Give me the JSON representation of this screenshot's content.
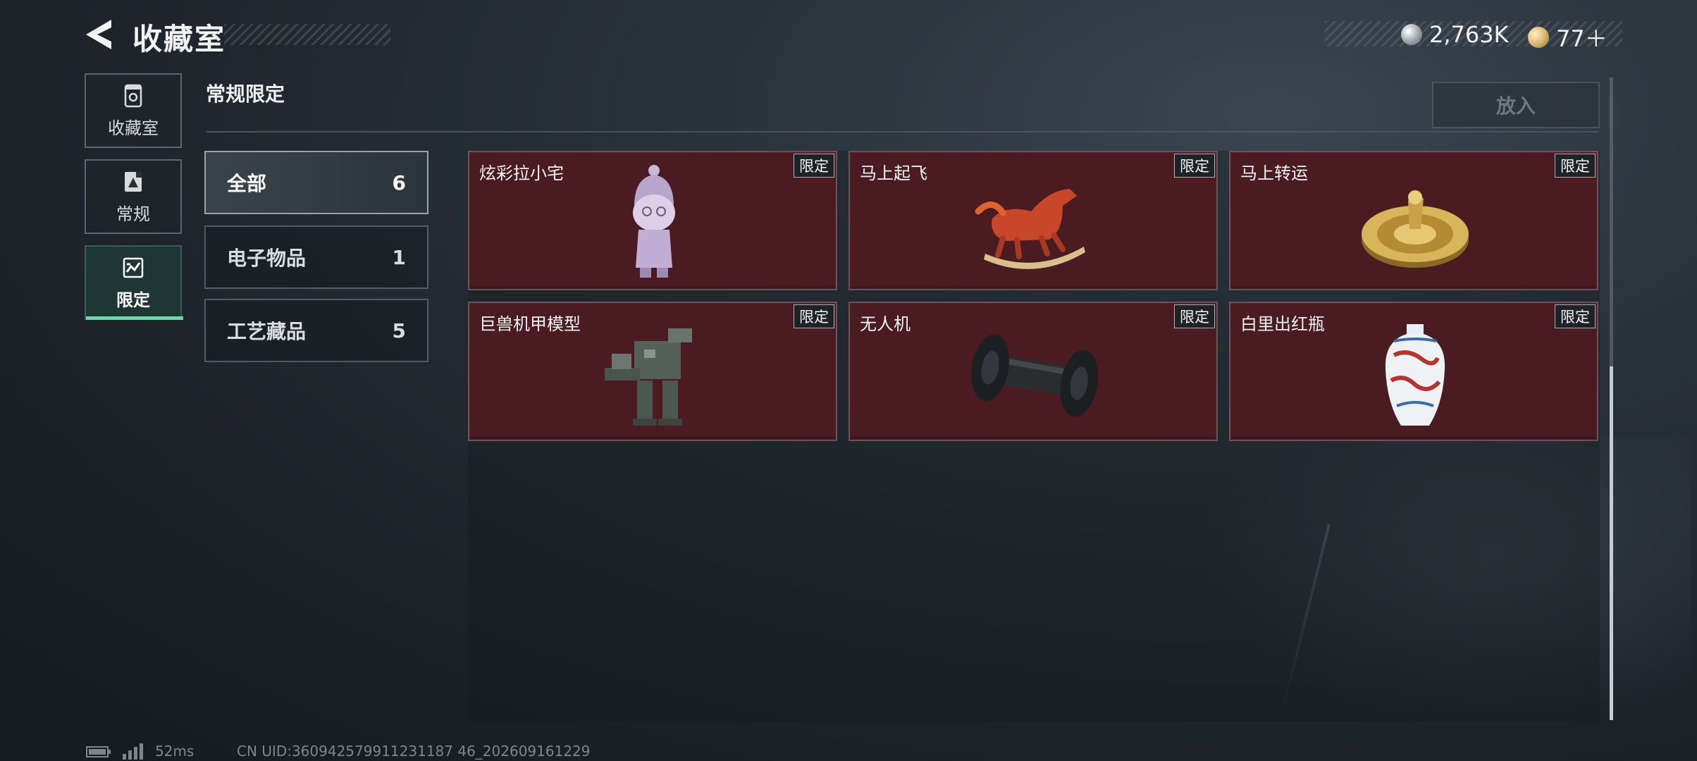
{
  "header": {
    "title": "收藏室",
    "currencies": [
      {
        "icon": "silver-coin-icon",
        "value": "2,763K"
      },
      {
        "icon": "gold-coin-icon",
        "value": "77＋"
      }
    ]
  },
  "nav": {
    "items": [
      {
        "label": "收藏室",
        "icon": "collection-box-icon",
        "active": false
      },
      {
        "label": "常规",
        "icon": "standard-icon",
        "active": false
      },
      {
        "label": "限定",
        "icon": "limited-icon",
        "active": true
      }
    ]
  },
  "section": {
    "title": "常规限定",
    "put_in_label": "放入"
  },
  "filters": [
    {
      "label": "全部",
      "count": "6",
      "active": true
    },
    {
      "label": "电子物品",
      "count": "1",
      "active": false
    },
    {
      "label": "工艺藏品",
      "count": "5",
      "active": false
    }
  ],
  "items": [
    {
      "name": "炫彩拉小宅",
      "badge": "限定",
      "icon": "figurine-icon"
    },
    {
      "name": "马上起飞",
      "badge": "限定",
      "icon": "horse-statue-icon"
    },
    {
      "name": "马上转运",
      "badge": "限定",
      "icon": "golden-disc-icon"
    },
    {
      "name": "巨兽机甲模型",
      "badge": "限定",
      "icon": "mech-model-icon"
    },
    {
      "name": "无人机",
      "badge": "限定",
      "icon": "drone-icon"
    },
    {
      "name": "白里出红瓶",
      "badge": "限定",
      "icon": "porcelain-vase-icon"
    }
  ],
  "status": {
    "ping": "52ms",
    "uid": "CN UID:360942579911231187 46_202609161229"
  },
  "colors": {
    "card_bg": "#4a1c22",
    "active_accent": "#6fd6a8"
  }
}
